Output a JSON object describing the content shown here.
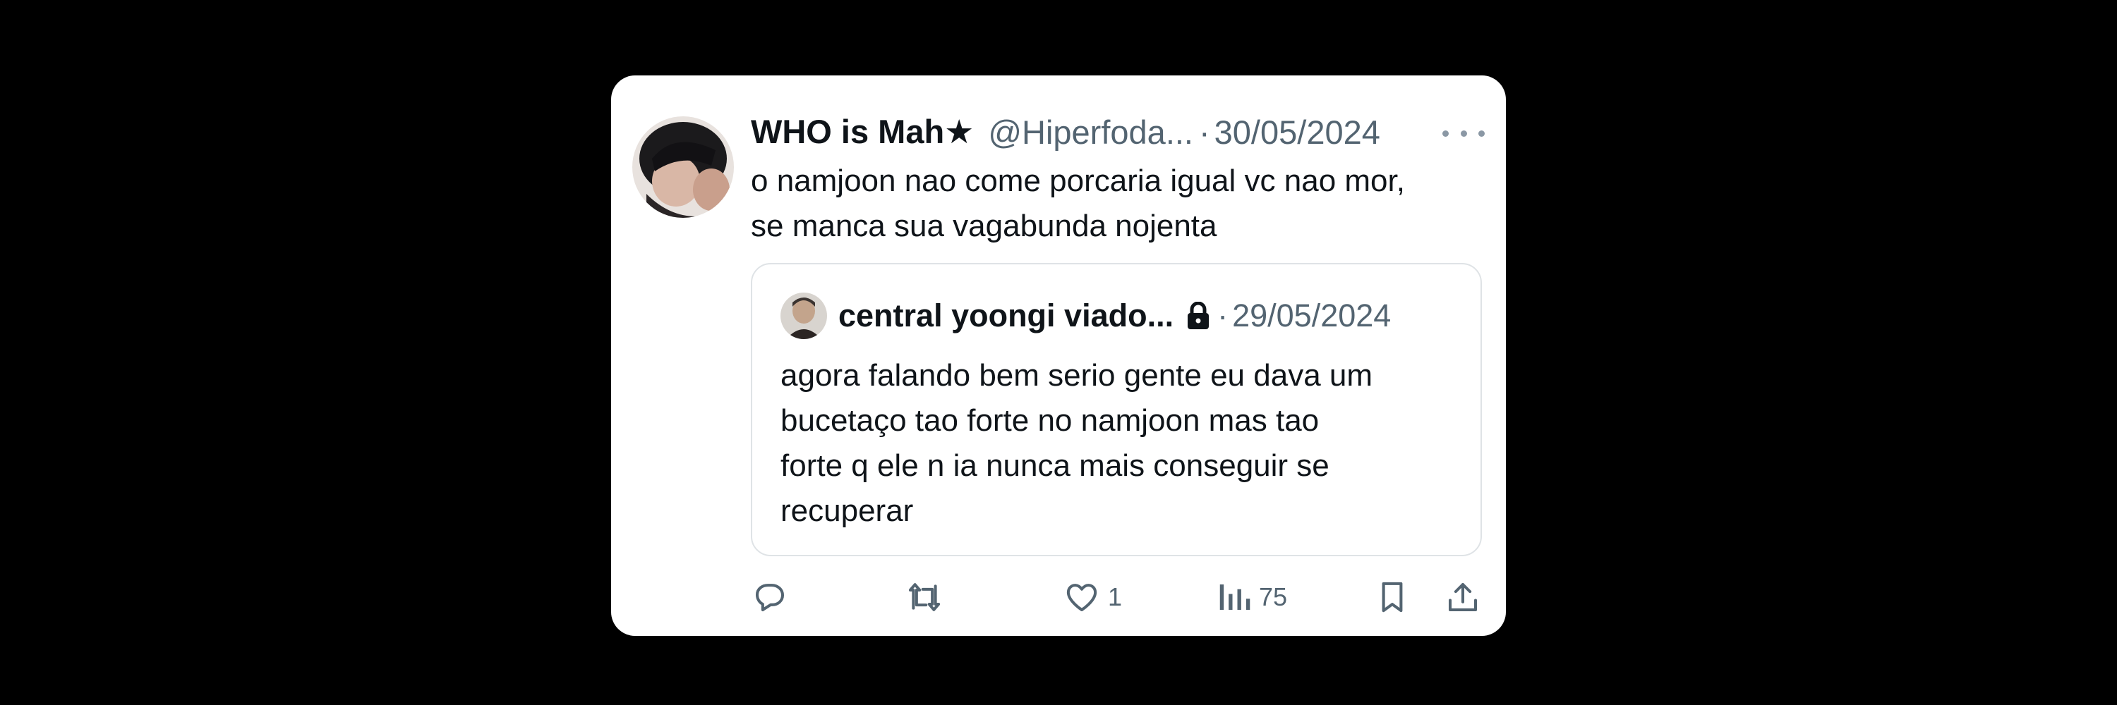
{
  "tweet": {
    "display_name": "WHO is Mah★",
    "handle": "@Hiperfoda...",
    "separator": "·",
    "date": "30/05/2024",
    "text_lines": [
      "o namjoon nao come porcaria igual vc nao mor,",
      "se manca sua vagabunda nojenta"
    ],
    "avatar": "profile-photo"
  },
  "quoted_tweet": {
    "display_name": "central yoongi viado...",
    "protected_icon": "lock-icon",
    "separator": "·",
    "date": "29/05/2024",
    "text_lines": [
      "agora falando bem serio gente eu dava um",
      "bucetaço tao forte no namjoon mas tao",
      "forte q ele n ia nunca mais conseguir se",
      "recuperar"
    ],
    "avatar": "profile-photo"
  },
  "actions": {
    "reply": {
      "icon": "reply-icon"
    },
    "retweet": {
      "icon": "retweet-icon"
    },
    "like": {
      "icon": "heart-icon",
      "count": "1"
    },
    "views": {
      "icon": "views-icon",
      "count": "75"
    },
    "bookmark": {
      "icon": "bookmark-icon"
    },
    "share": {
      "icon": "share-icon"
    }
  },
  "more_menu": {
    "icon": "more-horizontal-icon"
  },
  "colors": {
    "background": "#000000",
    "card": "#ffffff",
    "primary_text": "#0f1419",
    "secondary_text": "#536471",
    "border": "#dfe3e6"
  }
}
